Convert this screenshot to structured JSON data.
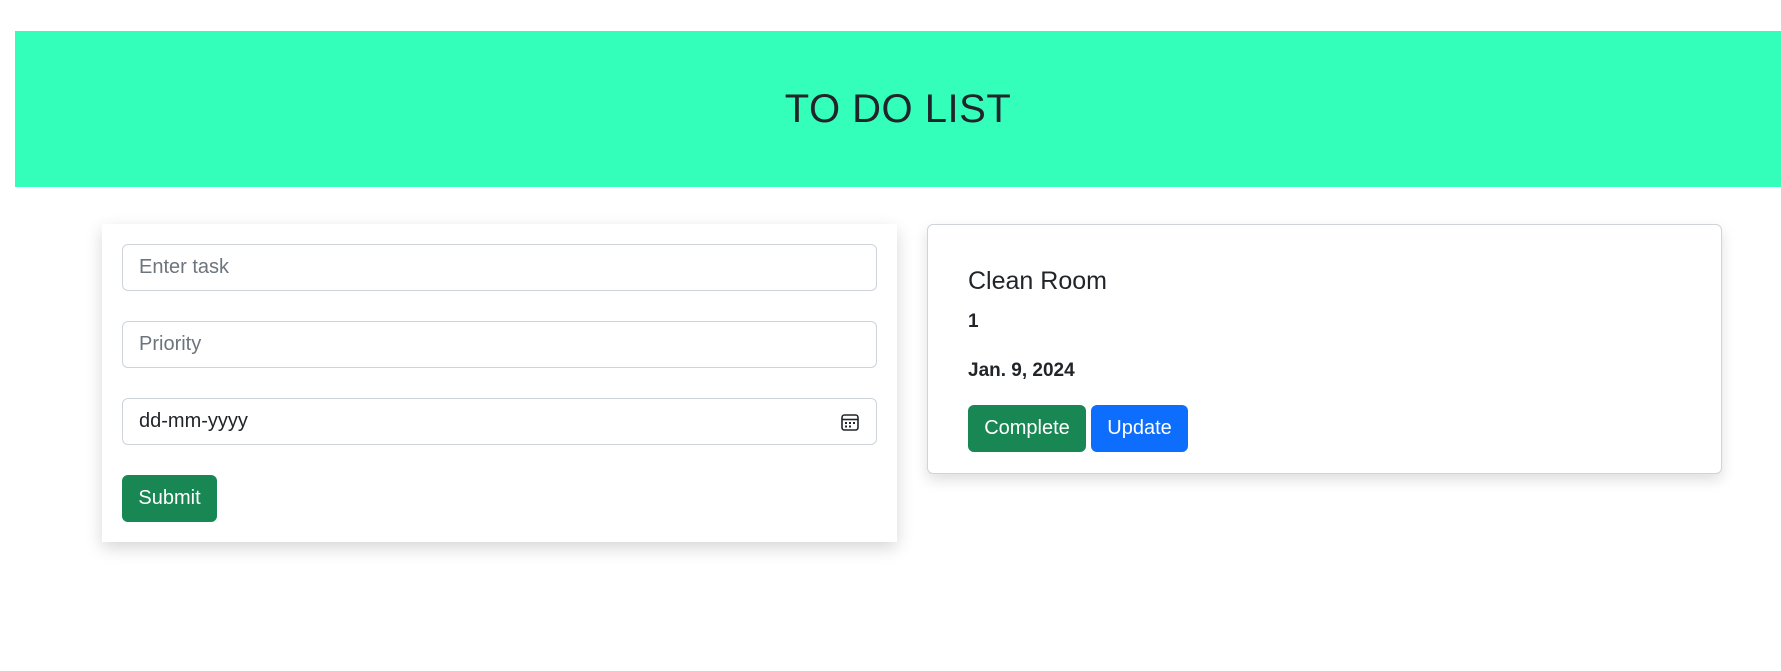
{
  "header": {
    "title": "TO DO LIST",
    "background_color": "#33ffbb"
  },
  "form": {
    "task_placeholder": "Enter task",
    "task_value": "",
    "priority_placeholder": "Priority",
    "priority_value": "",
    "date_display": "dd-mm-yyyy",
    "date_icon": "calendar-icon",
    "submit_label": "Submit"
  },
  "tasks": [
    {
      "title": "Clean Room",
      "priority": "1",
      "date": "Jan. 9, 2024",
      "complete_label": "Complete",
      "update_label": "Update"
    }
  ],
  "colors": {
    "success": "#198754",
    "primary": "#0d6efd"
  }
}
